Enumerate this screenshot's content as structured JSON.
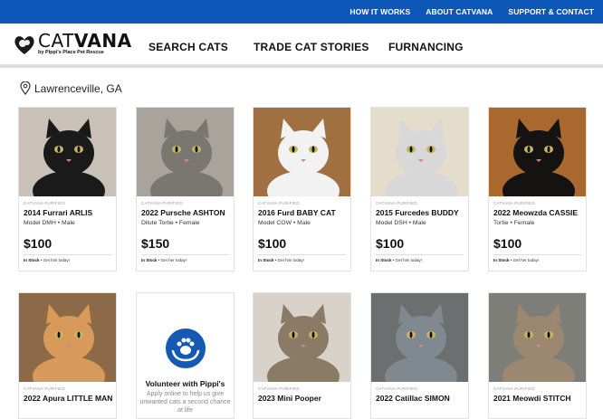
{
  "topnav": {
    "items": [
      "HOW IT WORKS",
      "ABOUT CATVANA",
      "SUPPORT & CONTACT"
    ]
  },
  "brand": {
    "name_thin": "CAT",
    "name_bold": "VANA",
    "tagline": "by Pippi's Place Pet Rescue"
  },
  "mainnav": {
    "items": [
      "SEARCH CATS",
      "TRADE CAT STORIES",
      "FURNANCING"
    ]
  },
  "location": "Lawrenceville, GA",
  "cards_row1": [
    {
      "badge": "CATVANA PURIFIED",
      "title": "2014 Furrari ARLIS",
      "model": "Model DMH • Male",
      "price": "$100",
      "stock_label": "In Stock",
      "stock_text": "• Get him today!",
      "fur": "#1a1a1a",
      "bg": "#c9c1b8"
    },
    {
      "badge": "CATVANA PURIFIED",
      "title": "2022 Pursche ASHTON",
      "model": "Dilute Tortie • Female",
      "price": "$150",
      "stock_label": "In Stock",
      "stock_text": "• Get her today!",
      "fur": "#7a7670",
      "bg": "#a8a49c"
    },
    {
      "badge": "CATVANA PURIFIED",
      "title": "2016 Furd BABY CAT",
      "model": "Model COW • Male",
      "price": "$100",
      "stock_label": "In Stock",
      "stock_text": "• Get him today!",
      "fur": "#f2f2f2",
      "bg": "#a07040"
    },
    {
      "badge": "CATVANA PURIFIED",
      "title": "2015 Furcedes BUDDY",
      "model": "Model DSH • Male",
      "price": "$100",
      "stock_label": "In Stock",
      "stock_text": "• Get him today!",
      "fur": "#d8d8d8",
      "bg": "#e6dccb"
    },
    {
      "badge": "CATVANA PURIFIED",
      "title": "2022 Meowzda CASSIE",
      "model": "Tortie • Female",
      "price": "$100",
      "stock_label": "In Stock",
      "stock_text": "• Get her today!",
      "fur": "#151212",
      "bg": "#a8682e"
    }
  ],
  "cards_row2": [
    {
      "badge": "CATVANA PURIFIED",
      "title": "2022 Apura LITTLE MAN",
      "fur": "#d79a5a",
      "bg": "#8c6a48"
    },
    {
      "vol_title": "Volunteer with Pippi's",
      "vol_text": "Apply online to help us give unwanted cats a second chance at life"
    },
    {
      "badge": "CATVANA PURIFIED",
      "title": "2023 Mini Pooper",
      "fur": "#8a7a66",
      "bg": "#d8d2ca"
    },
    {
      "badge": "CATVANA PURIFIED",
      "title": "2022 Catillac SIMON",
      "fur": "#808890",
      "bg": "#6c6f70"
    },
    {
      "badge": "CATVANA PURIFIED",
      "title": "2021 Meowdi STITCH",
      "fur": "#9c8870",
      "bg": "#7e7e78"
    }
  ],
  "colors": {
    "topbar": "#0d57b8",
    "volunteer_icon": "#1459b4"
  }
}
